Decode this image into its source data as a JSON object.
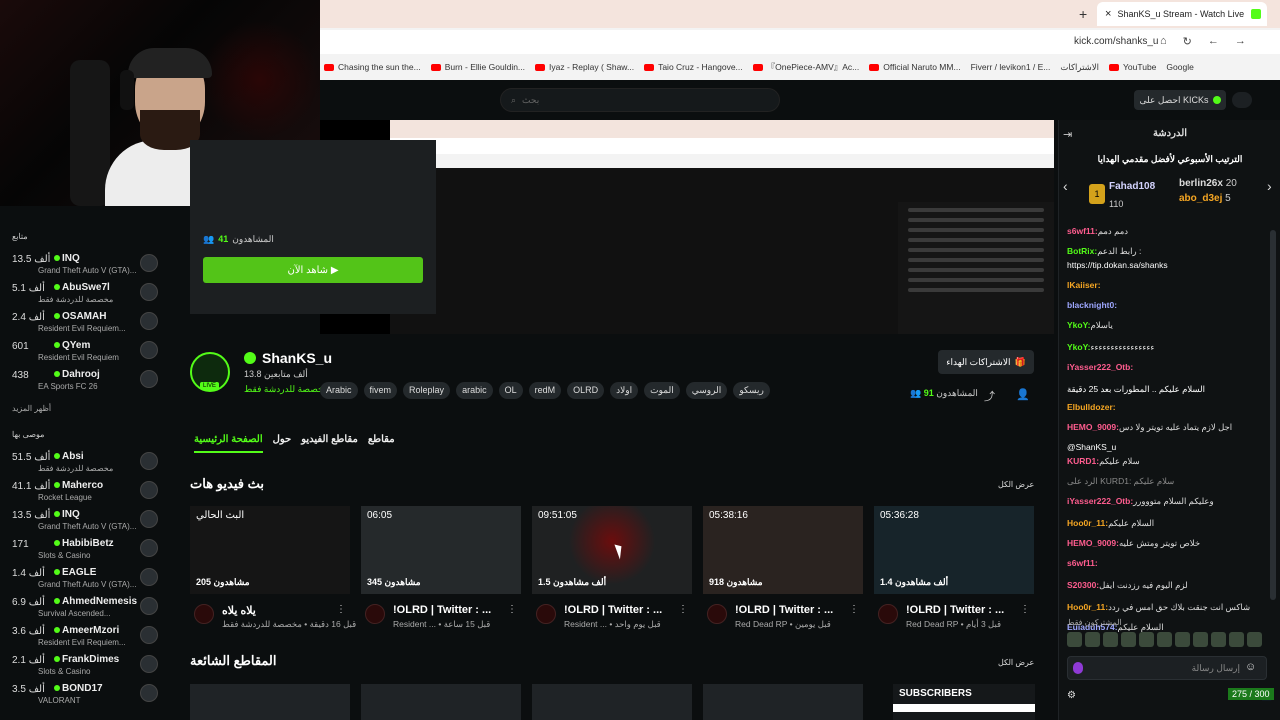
{
  "browser": {
    "tab_title": "ShanKS_u Stream - Watch Live",
    "new_tab": "+",
    "close_tab": "×",
    "url": "kick.com/shanks_u",
    "bookmarks": [
      "Chasing the sun the...",
      "Burn - Ellie Gouldin...",
      "Iyaz - Replay ( Shaw...",
      "Taio Cruz - Hangove...",
      "『OnePiece-AMV』Ac...",
      "Official Naruto MM...",
      "Fiverr / levikon1 / E...",
      "الاشتراكات",
      "YouTube",
      "Google"
    ]
  },
  "header": {
    "search_placeholder": "بحث",
    "get_kicks": "احصل على KICKs"
  },
  "popup": {
    "viewers_label": "المشاهدون",
    "viewers_count": "41",
    "watch_now": "شاهد الآن ▶"
  },
  "sidebar": {
    "following_title": "متابع",
    "following": [
      {
        "count": "13.5 ألف",
        "name": "INQ",
        "game": "Grand Theft Auto V (GTA)..."
      },
      {
        "count": "5.1 ألف",
        "name": "AbuSwe7l",
        "game": "مخصصة للدردشة فقط"
      },
      {
        "count": "2.4 ألف",
        "name": "OSAMAH",
        "game": "Resident Evil Requiem..."
      },
      {
        "count": "601",
        "name": "QYem",
        "game": "Resident Evil Requiem"
      },
      {
        "count": "438",
        "name": "Dahrooj",
        "game": "EA Sports FC 26"
      }
    ],
    "show_more": "أظهر المزيد",
    "recommended_title": "موصى بها",
    "recommended": [
      {
        "count": "51.5 ألف",
        "name": "Absi",
        "game": "مخصصة للدردشة فقط"
      },
      {
        "count": "41.1 ألف",
        "name": "Maherco",
        "game": "Rocket League"
      },
      {
        "count": "13.5 ألف",
        "name": "INQ",
        "game": "Grand Theft Auto V (GTA)..."
      },
      {
        "count": "171",
        "name": "HabibiBetz",
        "game": "Slots & Casino"
      },
      {
        "count": "1.4 ألف",
        "name": "EAGLE",
        "game": "Grand Theft Auto V (GTA)..."
      },
      {
        "count": "6.9 ألف",
        "name": "AhmedNemesis",
        "game": "Survival Ascended..."
      },
      {
        "count": "3.6 ألف",
        "name": "AmeerMzori",
        "game": "Resident Evil Requiem..."
      },
      {
        "count": "2.1 ألف",
        "name": "FrankDimes",
        "game": "Slots & Casino"
      },
      {
        "count": "3.5 ألف",
        "name": "BOND17",
        "game": "VALORANT"
      }
    ]
  },
  "channel": {
    "name": "ShanKS_u",
    "followers": "13.8 ألف متابعين",
    "category": "مخصصة للدردشة فقط",
    "live": "LIVE",
    "tags": [
      "Arabic",
      "fivem",
      "Roleplay",
      "arabic",
      "OL",
      "redM",
      "OLRD",
      "اولاد",
      "الموت",
      "الروسي",
      "ريسكو"
    ],
    "gift_button": "الاشتراكات الهداء",
    "viewers_label": "المشاهدون",
    "viewers_count": "91",
    "tabs": [
      "الصفحة الرئيسية",
      "حول",
      "مقاطع الفيديو",
      "مقاطع"
    ],
    "past_streams_title": "بث فيديو هات",
    "show_all": "عرض الكل",
    "clips_title": "المقاطع الشائعة",
    "subscribers_label": "SUBSCRIBERS"
  },
  "vods": [
    {
      "duration": "البث الحالي",
      "views": "205 مشاهدون",
      "title": "يلاه يلاه",
      "sub": "قبل 16 دقيقة • مخصصة للدردشة فقط"
    },
    {
      "duration": "06:05",
      "views": "345 مشاهدون",
      "title": "!OLRD | Twitter : ...",
      "sub": "Resident ... • قبل 15 ساعة"
    },
    {
      "duration": "09:51:05",
      "views": "1.5 ألف مشاهدون",
      "title": "!OLRD | Twitter : ...",
      "sub": "Resident ... • قبل يوم واحد"
    },
    {
      "duration": "05:38:16",
      "views": "918 مشاهدون",
      "title": "!OLRD | Twitter : ...",
      "sub": "Red Dead RP • قبل يومين"
    },
    {
      "duration": "05:36:28",
      "views": "1.4 ألف مشاهدون",
      "title": "!OLRD | Twitter : ...",
      "sub": "Red Dead RP • قبل 3 أيام"
    }
  ],
  "chat": {
    "title": "الدردشة",
    "leaderboard_title": "الترتيب الأسبوعي لأفضل مقدمي الهدايا",
    "first": {
      "rank": "1",
      "name": "Fahad108",
      "score": "110"
    },
    "second": [
      {
        "name": "berlin26x",
        "score": "20"
      },
      {
        "name": "abo_d3ej",
        "score": "5"
      }
    ],
    "messages": [
      {
        "user": "s6wf11:",
        "text": "دمم دمم",
        "color": "#ff5d8f"
      },
      {
        "user": "BotRix:",
        "text": "رابط الدعم :",
        "color": "#53fc18"
      },
      {
        "user": "",
        "text": "https://tip.dokan.sa/shanks",
        "color": "#ffffff"
      },
      {
        "user": "lKaiiser:",
        "text": "",
        "color": "#f5a623"
      },
      {
        "user": "blacknight0:",
        "text": "",
        "color": "#9ea7ff"
      },
      {
        "user": "YkoY:",
        "text": "ياسلام",
        "color": "#53fc18"
      },
      {
        "user": "YkoY:",
        "text": "ءءءءءءءءءءءءءءءء",
        "color": "#53fc18"
      },
      {
        "user": "iYasser222_Otb:",
        "text": "",
        "color": "#ff5d8f"
      },
      {
        "user": "",
        "text": "السلام عليكم .. المطورات بعد 25 دقيقة",
        "color": "#ffffff"
      },
      {
        "user": "Elbulldozer:",
        "text": "",
        "color": "#f5a623"
      },
      {
        "user": "HEMO_9009:",
        "text": "اجل لازم يتماد عليه تويتر ولا دس",
        "color": "#ff5d8f"
      },
      {
        "user": "",
        "text": "@ShanKS_u",
        "color": "#ffffff"
      },
      {
        "user": "KURD1:",
        "text": "سلام عليكم",
        "color": "#ff5d8f"
      },
      {
        "user": "",
        "text": "الرد على KURD1: سلام عليكم",
        "color": "#888888"
      },
      {
        "user": "iYasser222_Otb:",
        "text": "وعليكم السلام متووورر",
        "color": "#ff5d8f"
      },
      {
        "user": "Hoo0r_11:",
        "text": "السلام عليكم",
        "color": "#f5a623"
      },
      {
        "user": "HEMO_9009:",
        "text": "خلاص تويتر ومتش عليه",
        "color": "#ff5d8f"
      },
      {
        "user": "s6wf11:",
        "text": "",
        "color": "#ff5d8f"
      },
      {
        "user": "S20300:",
        "text": "لزم اليوم فيه رزدنت ايفل",
        "color": "#ff5d8f"
      },
      {
        "user": "Hoo0r_11:",
        "text": "شاكس انت جنقت بلاك حق امس في ردد",
        "color": "#f5a623"
      },
      {
        "user": "Euiaduh574:",
        "text": "السلام عليكم",
        "color": "#9ea7ff"
      }
    ],
    "subs_only": "المشتركون فقط",
    "input_placeholder": "إرسال رسالة",
    "counter": "275 / 300"
  }
}
